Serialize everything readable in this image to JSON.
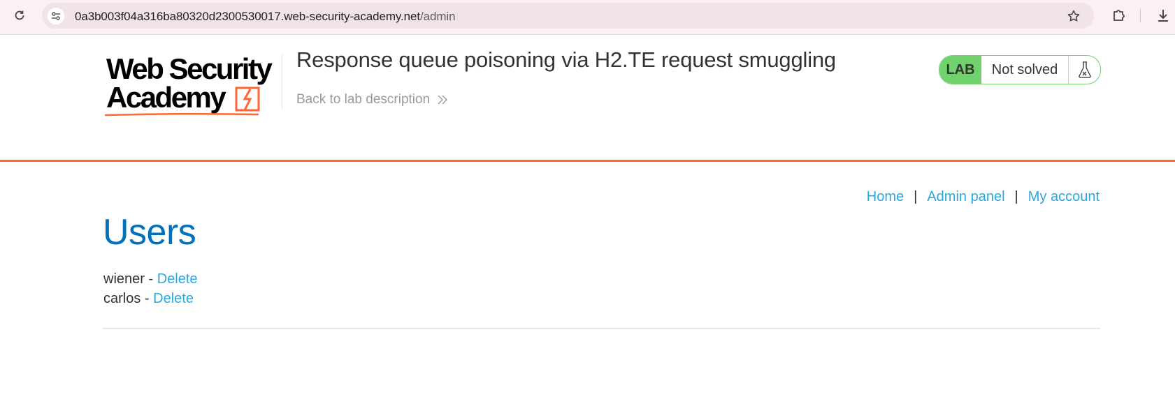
{
  "browser": {
    "url_host": "0a3b003f04a316ba80320d2300530017.web-security-academy.net",
    "url_path": "/admin"
  },
  "logo": {
    "line1": "Web Security",
    "line2": "Academy"
  },
  "lab": {
    "title": "Response queue poisoning via H2.TE request smuggling",
    "back_link": "Back to lab description",
    "tag": "LAB",
    "status": "Not solved",
    "accent_color": "#70d16d"
  },
  "nav": {
    "home": "Home",
    "admin_panel": "Admin panel",
    "my_account": "My account",
    "separator": "|"
  },
  "page": {
    "heading": "Users",
    "users": [
      {
        "name": "wiener",
        "separator": " - ",
        "action": "Delete"
      },
      {
        "name": "carlos",
        "separator": " - ",
        "action": "Delete"
      }
    ]
  },
  "colors": {
    "brand_orange": "#ff6633",
    "link_blue": "#29a8e0",
    "heading_blue": "#0071bc"
  }
}
